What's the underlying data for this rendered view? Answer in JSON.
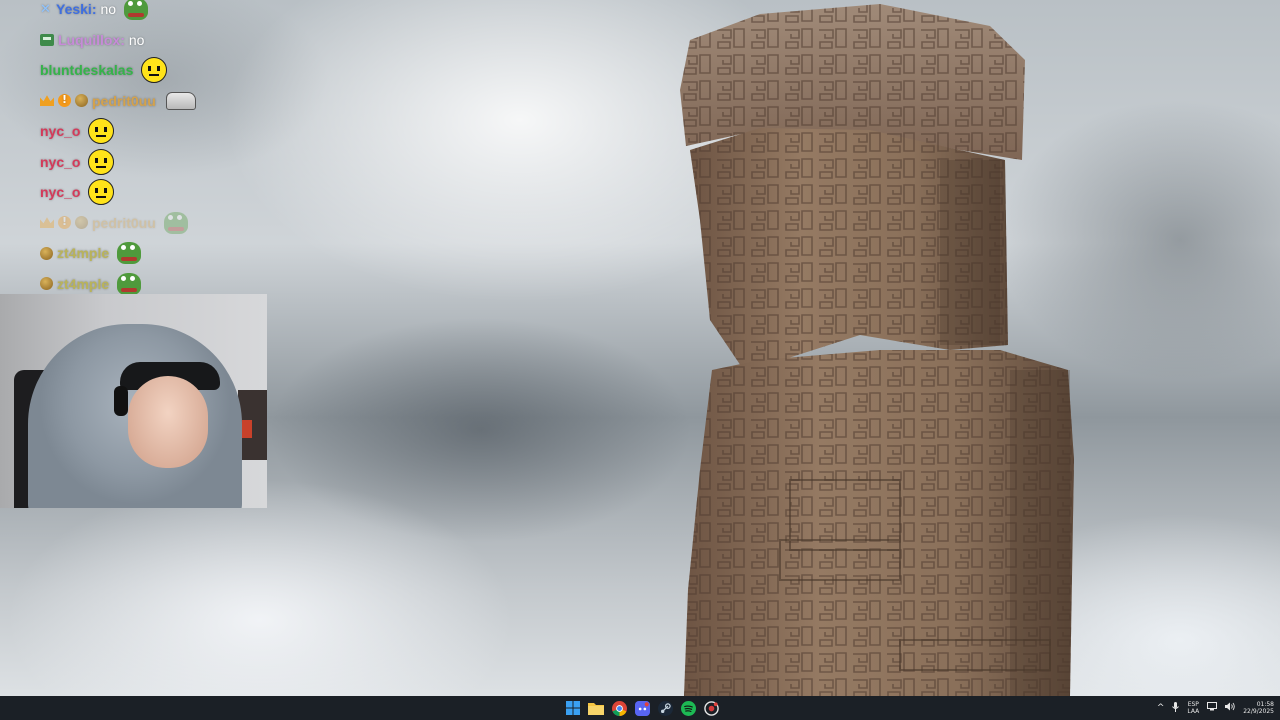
{
  "chat": {
    "lines": [
      {
        "badges": [
          "x"
        ],
        "user": "Yeski",
        "user_color": "#3f6fe0",
        "message": "no",
        "emote": "frog"
      },
      {
        "badges": [
          "bot"
        ],
        "user": "Luquillox",
        "user_color": "#c78bd8",
        "message": "no",
        "emote": ""
      },
      {
        "badges": [],
        "user": "bluntdeskalas",
        "user_color": "#35b44a",
        "message": "",
        "emote": "face"
      },
      {
        "badges": [
          "crown",
          "alert",
          "coin"
        ],
        "user": "pedrit0uu",
        "user_color": "#d4a24c",
        "message": "",
        "emote": "car"
      },
      {
        "badges": [],
        "user": "nyc_o",
        "user_color": "#d43a5a",
        "message": "",
        "emote": "face"
      },
      {
        "badges": [],
        "user": "nyc_o",
        "user_color": "#d43a5a",
        "message": "",
        "emote": "face"
      },
      {
        "badges": [],
        "user": "nyc_o",
        "user_color": "#d43a5a",
        "message": "",
        "emote": "face"
      },
      {
        "badges": [
          "crown",
          "alert",
          "coin"
        ],
        "user": "pedrit0uu",
        "user_color": "#d4a24c",
        "message": "",
        "emote": "frog",
        "faded": true
      },
      {
        "badges": [
          "coin"
        ],
        "user": "zt4mple",
        "user_color": "#b9b35a",
        "message": "",
        "emote": "frog"
      },
      {
        "badges": [
          "coin"
        ],
        "user": "zt4mple",
        "user_color": "#b9b35a",
        "message": "",
        "emote": "frog"
      }
    ]
  },
  "taskbar": {
    "apps": [
      "start-icon",
      "file-explorer-icon",
      "chrome-icon",
      "discord-icon",
      "steam-icon",
      "spotify-icon",
      "app-icon"
    ],
    "tray": {
      "chevron": "^",
      "language_top": "ESP",
      "language_bottom": "LAA",
      "time": "01:58",
      "date": "22/9/2025"
    }
  },
  "colors": {
    "taskbar_bg": "#1b2026",
    "spotify": "#1db954",
    "chrome_red": "#db4437",
    "discord": "#5865f2"
  }
}
